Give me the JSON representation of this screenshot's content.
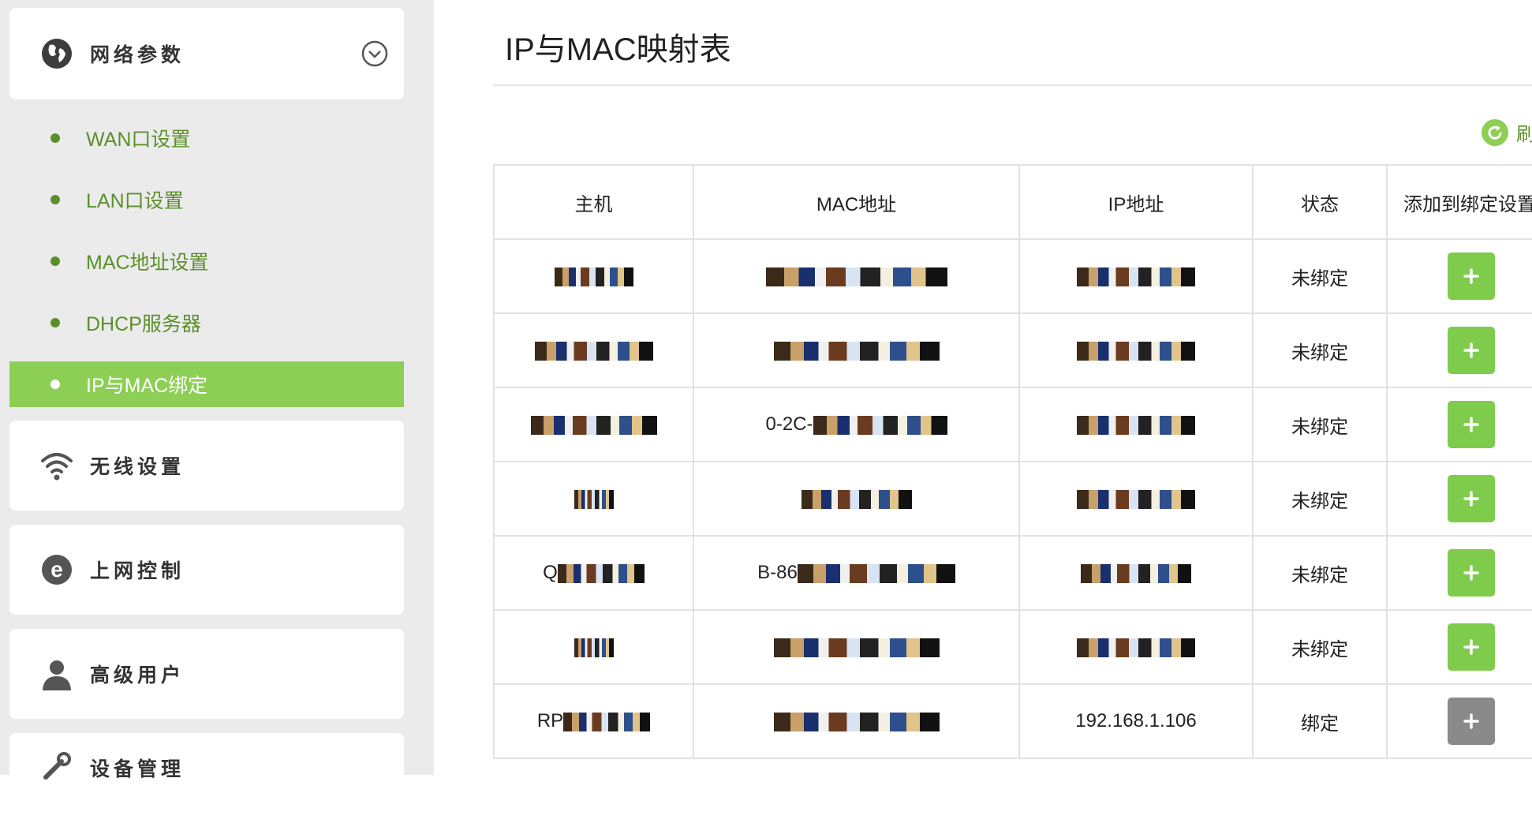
{
  "sidebar": {
    "network_params": {
      "label": "网络参数",
      "icon": "globe-icon",
      "expanded": true
    },
    "subitems": [
      {
        "label": "WAN口设置",
        "active": false
      },
      {
        "label": "LAN口设置",
        "active": false
      },
      {
        "label": "MAC地址设置",
        "active": false
      },
      {
        "label": "DHCP服务器",
        "active": false
      },
      {
        "label": "IP与MAC绑定",
        "active": true
      }
    ],
    "groups": [
      {
        "label": "无线设置",
        "icon": "wifi-icon"
      },
      {
        "label": "上网控制",
        "icon": "e-icon"
      },
      {
        "label": "高级用户",
        "icon": "user-icon"
      },
      {
        "label": "设备管理",
        "icon": "tools-icon"
      }
    ]
  },
  "main": {
    "title": "IP与MAC映射表",
    "refresh_label": "刷新",
    "table": {
      "headers": [
        "主机",
        "MAC地址",
        "IP地址",
        "状态",
        "添加到绑定设置"
      ],
      "rows": [
        {
          "host": "",
          "mac": "",
          "ip": "",
          "status": "未绑定",
          "bound": false
        },
        {
          "host": "",
          "mac": "",
          "ip": "",
          "status": "未绑定",
          "bound": false
        },
        {
          "host": "",
          "mac": "0-2C-",
          "ip": "",
          "status": "未绑定",
          "bound": false
        },
        {
          "host": "",
          "mac": "",
          "ip": "",
          "status": "未绑定",
          "bound": false
        },
        {
          "host": "Q",
          "mac": "B-86",
          "ip": "",
          "status": "未绑定",
          "bound": false
        },
        {
          "host": "",
          "mac": "",
          "ip": "",
          "status": "未绑定",
          "bound": false
        },
        {
          "host": "RP",
          "mac": "",
          "ip": "192.168.1.106",
          "status": "绑定",
          "bound": true
        }
      ]
    }
  },
  "colors": {
    "accent": "#8dcf55",
    "accent_dark": "#5b8f2b",
    "disabled": "#8a8a8a"
  }
}
